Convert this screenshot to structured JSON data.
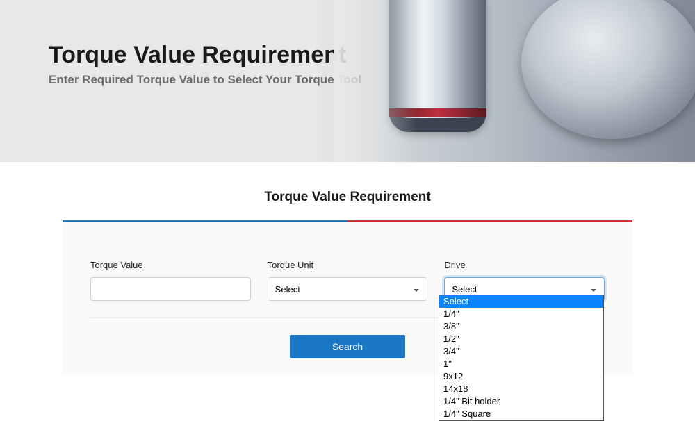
{
  "hero": {
    "title": "Torque Value Requirement",
    "subtitle": "Enter Required Torque Value to Select Your Torque Tool"
  },
  "section": {
    "title": "Torque Value Requirement"
  },
  "form": {
    "torque_value": {
      "label": "Torque Value",
      "value": ""
    },
    "torque_unit": {
      "label": "Torque Unit",
      "selected": "Select"
    },
    "drive": {
      "label": "Drive",
      "selected": "Select"
    },
    "drive_options": [
      "Select",
      "1/4\"",
      "3/8\"",
      "1/2\"",
      "3/4\"",
      "1\"",
      "9x12",
      "14x18",
      "1/4\" Bit holder",
      "1/4\" Square"
    ]
  },
  "buttons": {
    "search": "Search"
  }
}
